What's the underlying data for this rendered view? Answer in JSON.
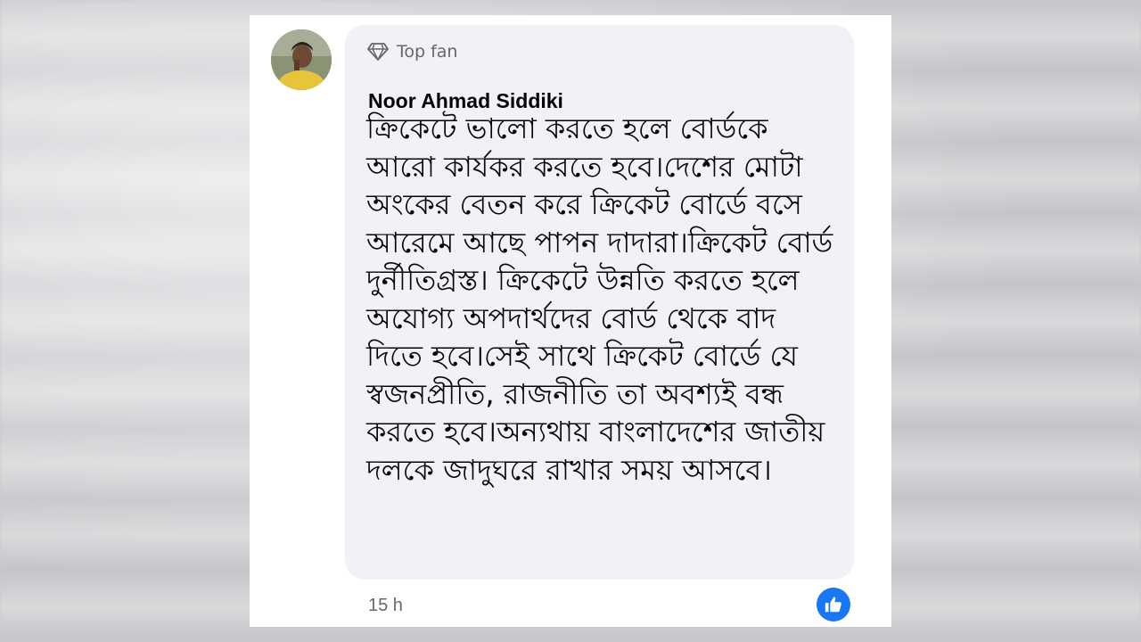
{
  "comment": {
    "badge_label": "Top fan",
    "author": "Noor Ahmad Siddiki",
    "text": "ক্রিকেটে ভালো করতে হলে বোর্ডকে আরো কার্যকর করতে হবে।দেশের মোটা অংকের বেতন করে ক্রিকেট বোর্ডে বসে আরেমে আছে পাপন দাদারা।ক্রিকেট বোর্ড দুর্নীতিগ্রস্ত। ক্রিকেটে উন্নতি করতে হলে অযোগ্য অপদার্থদের বোর্ড থেকে বাদ দিতে হবে।সেই সাথে ক্রিকেট বোর্ডে যে স্বজনপ্রীতি, রাজনীতি তা অবশ্যই বন্ধ করতে হবে।অন্যথায় বাংলাদেশের জাতীয় দলকে জাদুঘরে রাখার সময় আসবে।",
    "timestamp": "15 h",
    "badge_icon": "diamond-icon",
    "reaction_icon": "like-icon",
    "accent_color": "#1877f2"
  }
}
